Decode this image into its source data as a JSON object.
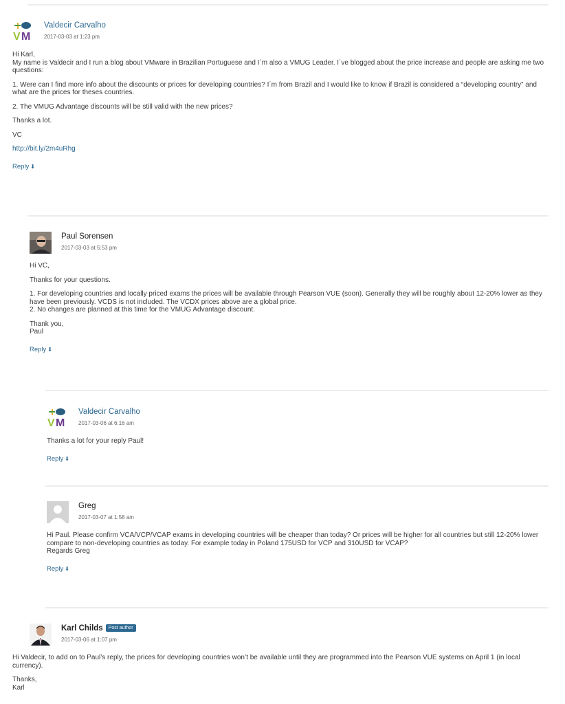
{
  "comments": [
    {
      "author": "Valdecir Carvalho",
      "date": "2017-03-03 at 1:23 pm",
      "avatar": "vm-logo",
      "paragraphs": [
        "Hi Karl,\nMy name is Valdecir and I run a blog about VMware in Brazilian Portuguese and I´m also a VMUG Leader. I´ve blogged about the price increase and people are asking me two questions:",
        "1. Were can I find more info about the discounts or prices for developing countries? I´m from Brazil and I would like to know if Brazil is considered a “developing country” and what are the prices for theses countries.",
        "2. The VMUG Advantage discounts will be still valid with the new prices?",
        "Thanks a lot.",
        "VC"
      ],
      "link": "http://bit.ly/2m4uRhg",
      "reply": "Reply"
    },
    {
      "author": "Paul Sorensen",
      "date": "2017-03-03 at 5:53 pm",
      "avatar": "photo",
      "paragraphs": [
        "Hi VC,",
        "Thanks for your questions.",
        "1. For developing countries and locally priced exams the prices will be available through Pearson VUE (soon). Generally they will be roughly about 12-20% lower as they have been previously. VCDS is not included. The VCDX prices above are a global price.\n2. No changes are planned at this time for the VMUG Advantage discount.",
        "Thank you,\nPaul"
      ],
      "reply": "Reply"
    },
    {
      "author": "Valdecir Carvalho",
      "date": "2017-03-06 at 6:16 am",
      "avatar": "vm-logo",
      "paragraphs": [
        "Thanks a lot for your reply Paul!"
      ],
      "reply": "Reply"
    },
    {
      "author": "Greg",
      "date": "2017-03-07 at 1:58 am",
      "avatar": "default-person",
      "paragraphs": [
        "Hi Paul. Please confirm VCA/VCP/VCAP exams in developing countries will be cheaper than today? Or prices will be higher for all countries but still 12-20% lower compare to non-developing countries as today. For example today in Poland 175USD for VCP and 310USD for VCAP?\nRegards Greg"
      ],
      "reply": "Reply"
    },
    {
      "author": "Karl Childs",
      "badge": "Post author",
      "date": "2017-03-06 at 1:07 pm",
      "avatar": "photo",
      "paragraphs": [
        "Hi Valdecir, to add on to Paul’s reply, the prices for developing countries won’t be available until they are programmed into the Pearson VUE systems on April 1 (in local currency).",
        "Thanks,\nKarl"
      ]
    }
  ],
  "reply_arrow": "⬇",
  "colors": {
    "link": "#2c6891",
    "badge_bg": "#2c6891",
    "divider": "#ececec"
  }
}
